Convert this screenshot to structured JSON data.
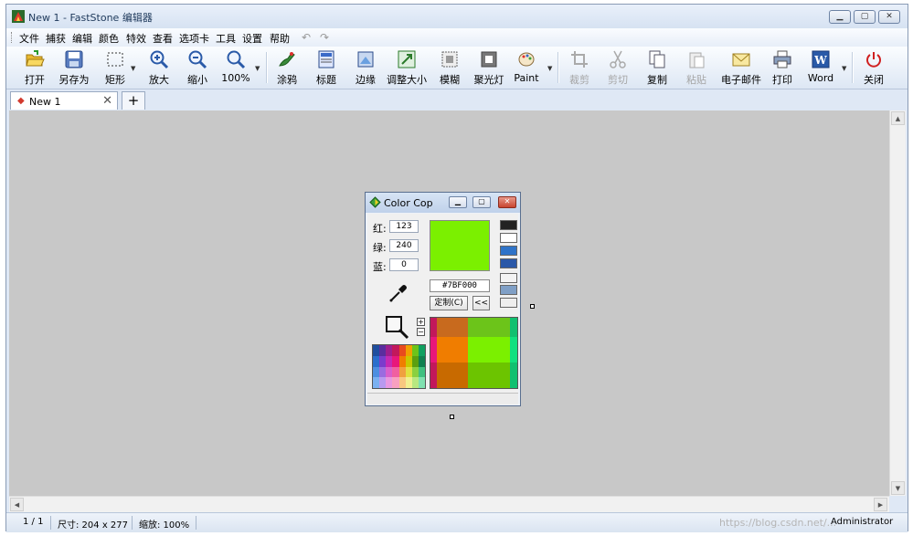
{
  "window": {
    "title": "New 1 - FastStone 编辑器"
  },
  "menu": [
    "文件",
    "捕获",
    "编辑",
    "颜色",
    "特效",
    "查看",
    "选项卡",
    "工具",
    "设置",
    "帮助"
  ],
  "toolbar": {
    "open": "打开",
    "save_as": "另存为",
    "rect": "矩形",
    "zoom_in": "放大",
    "zoom_out": "缩小",
    "zoom": "100%",
    "draw": "涂鸦",
    "caption": "标题",
    "edge": "边缘",
    "resize": "调整大小",
    "blur": "模糊",
    "spotlight": "聚光灯",
    "paint": "Paint",
    "crop": "裁剪",
    "cut": "剪切",
    "copy": "复制",
    "paste": "粘贴",
    "email": "电子邮件",
    "print": "打印",
    "word": "Word",
    "close": "关闭"
  },
  "tabs": {
    "active": "New 1",
    "add": "+"
  },
  "status": {
    "page": "1 / 1",
    "size": "尺寸: 204 x 277",
    "zoom": "缩放: 100%",
    "watermark": "https://blog.csdn.net/...",
    "user": "Administrator"
  },
  "colorcop": {
    "title": "Color Cop",
    "red_label": "红:",
    "green_label": "绿:",
    "blue_label": "蓝:",
    "red": "123",
    "green": "240",
    "blue": "0",
    "hex": "#7BF000",
    "custom_label": "定制(C)",
    "collapse_label": "<<",
    "current_color": "#7BF000",
    "history": [
      "#222222",
      "#ffffff",
      "#2f73c8",
      "#2a58a8",
      "#f3f3f3",
      "#7f9fc6",
      "#eeeeee"
    ],
    "zoom_colors": [
      [
        "#c2185b",
        "#c86a1e",
        "#c86a1e",
        "#6cc41a",
        "#6cc41a",
        "#10c070"
      ],
      [
        "#e8177a",
        "#f07d00",
        "#f07d00",
        "#7bf000",
        "#7bf000",
        "#10e080"
      ],
      [
        "#c2185b",
        "#c86a00",
        "#c86a00",
        "#6cc400",
        "#6cc400",
        "#10c070"
      ]
    ],
    "palette": [
      "#1f4e9e",
      "#5a2e9e",
      "#9e1f8e",
      "#c2185b",
      "#e84a1e",
      "#f0a000",
      "#6cc41a",
      "#10a060",
      "#2a6ecc",
      "#7a3ccc",
      "#c42ab4",
      "#e8177a",
      "#f07d00",
      "#c8c800",
      "#5aa010",
      "#108050",
      "#4d8ee0",
      "#9a6ce0",
      "#d860cc",
      "#f060a0",
      "#f0a040",
      "#e0e040",
      "#8ad040",
      "#40c080",
      "#7ab0f0",
      "#b89af0",
      "#e898e0",
      "#f8a0c0",
      "#f8c880",
      "#f0f090",
      "#b8e880",
      "#80e0b0"
    ]
  }
}
